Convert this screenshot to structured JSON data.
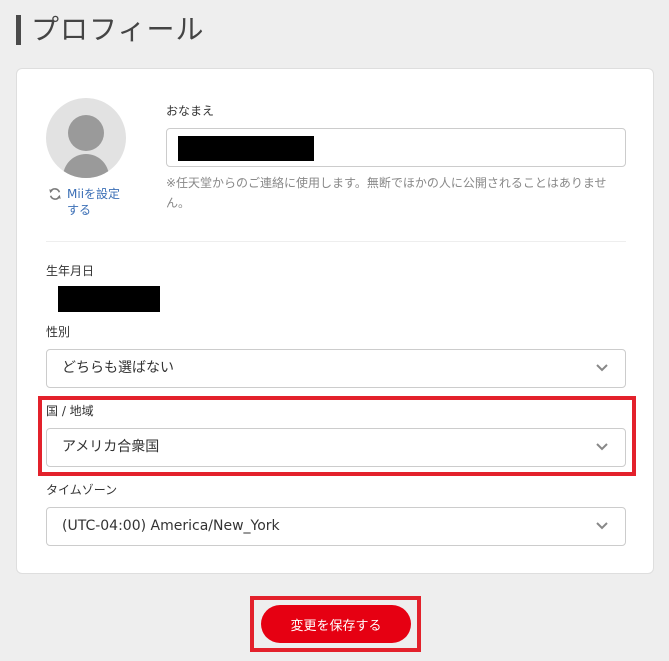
{
  "page": {
    "title": "プロフィール"
  },
  "profile": {
    "mii_link_label": "Miiを設定する",
    "name_label": "おなまえ",
    "name_note": "※任天堂からのご連絡に使用します。無断でほかの人に公開されることはありません。",
    "birthdate_label": "生年月日",
    "gender_label": "性別",
    "gender_value": "どちらも選ばない",
    "country_label": "国 / 地域",
    "country_value": "アメリカ合衆国",
    "timezone_label": "タイムゾーン",
    "timezone_value": "(UTC-04:00) America/New_York"
  },
  "actions": {
    "save_label": "変更を保存する"
  },
  "icons": {
    "mii_refresh": "refresh-icon",
    "dropdown": "chevron-down-icon"
  },
  "colors": {
    "accent_red": "#e60012",
    "highlight_red": "#e3212b",
    "link_blue": "#3b6fb6"
  }
}
